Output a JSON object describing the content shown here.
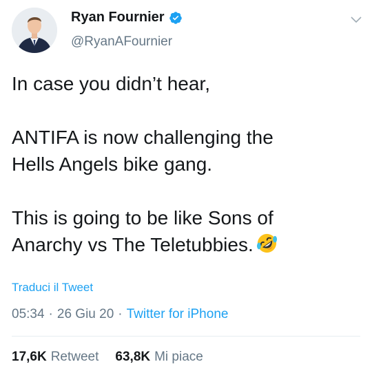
{
  "user": {
    "display_name": "Ryan Fournier",
    "handle": "@RyanAFournier"
  },
  "tweet": {
    "line1": "In case you didn’t hear,",
    "line2": "ANTIFA is now challenging the\nHells Angels bike gang.",
    "line3": "This is going to be like Sons of\nAnarchy vs The Teletubbies.",
    "emoji_icon": "rolling-on-floor-laughing-emoji"
  },
  "translate_label": "Traduci il Tweet",
  "meta": {
    "time": "05:34",
    "date": "26 Giu 20",
    "source": "Twitter for iPhone",
    "separator": "·"
  },
  "stats": {
    "retweets_count": "17,6K",
    "retweets_label": "Retweet",
    "likes_count": "63,8K",
    "likes_label": "Mi piace"
  },
  "colors": {
    "link": "#1da1f2",
    "secondary": "#657786",
    "verified": "#1da1f2"
  }
}
